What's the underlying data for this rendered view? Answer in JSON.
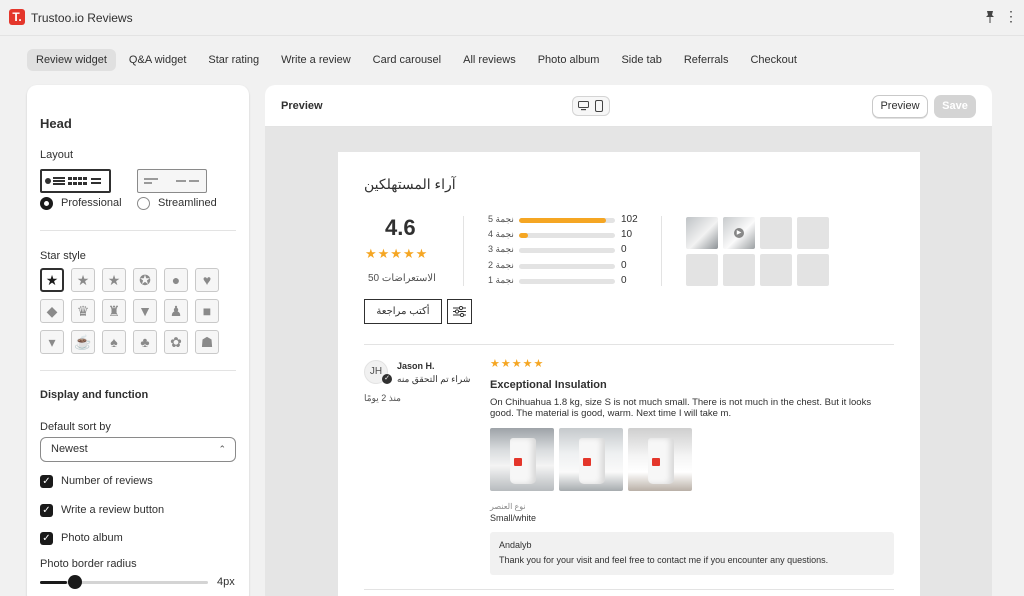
{
  "app": {
    "logo_letter": "T.",
    "title": "Trustoo.io Reviews",
    "brand_color": "#e4362b"
  },
  "topbar_icons": [
    "pin-icon",
    "more-icon"
  ],
  "tabs": [
    {
      "label": "Review widget",
      "active": true
    },
    {
      "label": "Q&A widget"
    },
    {
      "label": "Star rating"
    },
    {
      "label": "Write a review"
    },
    {
      "label": "Card carousel"
    },
    {
      "label": "All reviews"
    },
    {
      "label": "Photo album"
    },
    {
      "label": "Side tab"
    },
    {
      "label": "Referrals"
    },
    {
      "label": "Checkout"
    }
  ],
  "settings": {
    "head_title": "Head",
    "layout_label": "Layout",
    "layout_options": [
      {
        "label": "Professional",
        "selected": true
      },
      {
        "label": "Streamlined",
        "selected": false
      }
    ],
    "star_style_label": "Star style",
    "star_styles": [
      {
        "icon": "star-solid-icon",
        "glyph": "★",
        "selected": true
      },
      {
        "icon": "star-rounded-icon",
        "glyph": "★"
      },
      {
        "icon": "star-thin-icon",
        "glyph": "★"
      },
      {
        "icon": "star-square-icon",
        "glyph": "✪"
      },
      {
        "icon": "drop-icon",
        "glyph": "●"
      },
      {
        "icon": "heart-icon",
        "glyph": "♥"
      },
      {
        "icon": "diamond-icon",
        "glyph": "◆"
      },
      {
        "icon": "crown-icon",
        "glyph": "♛"
      },
      {
        "icon": "trophy-icon",
        "glyph": "♜"
      },
      {
        "icon": "shirt-icon",
        "glyph": "▼"
      },
      {
        "icon": "dress-icon",
        "glyph": "♟"
      },
      {
        "icon": "bag-icon",
        "glyph": "■"
      },
      {
        "icon": "tie-icon",
        "glyph": "▾"
      },
      {
        "icon": "cup-icon",
        "glyph": "☕"
      },
      {
        "icon": "leaf-icon",
        "glyph": "♠"
      },
      {
        "icon": "sprout-icon",
        "glyph": "♣"
      },
      {
        "icon": "paw-icon",
        "glyph": "✿"
      },
      {
        "icon": "chef-hat-icon",
        "glyph": "☗"
      }
    ],
    "display_title": "Display and function",
    "sort_label": "Default sort by",
    "sort_value": "Newest",
    "checkboxes": [
      {
        "label": "Number of reviews",
        "checked": true
      },
      {
        "label": "Write a review button",
        "checked": true
      },
      {
        "label": "Photo album",
        "checked": true
      }
    ],
    "radius_label": "Photo border radius",
    "radius_value": "4px",
    "radius_fraction": 0.16
  },
  "preview": {
    "label": "Preview",
    "preview_button": "Preview",
    "save_button": "Save",
    "device_icons": [
      "desktop-icon",
      "mobile-icon"
    ]
  },
  "widget": {
    "title": "آراء المستهلكين",
    "average": "4.6",
    "average_stars": "★★★★★",
    "total_text": "50 الاستعراضات",
    "breakdown": [
      {
        "label": "5 نجمة",
        "count": 102,
        "fraction": 0.91
      },
      {
        "label": "4 نجمة",
        "count": 10,
        "fraction": 0.09
      },
      {
        "label": "3 نجمة",
        "count": 0,
        "fraction": 0
      },
      {
        "label": "2 نجمة",
        "count": 0,
        "fraction": 0
      },
      {
        "label": "1 نجمة",
        "count": 0,
        "fraction": 0
      }
    ],
    "write_button": "أكتب مراجعة",
    "review": {
      "initials": "JH",
      "author": "Jason H.",
      "verified_text": "شراء تم التحقق منه",
      "time_ago": "منذ 2 يومًا",
      "stars": "★★★★★",
      "title": "Exceptional Insulation",
      "body_line1": "On Chihuahua 1.8 kg, size S is not much small. There is not much in the chest. But it looks",
      "body_line2": "good. The material is good, warm. Next time I will take m.",
      "variant_label": "نوع العنصر",
      "variant_value": "Small/white",
      "reply_author": "Andalyb",
      "reply_text": "Thank you for your visit and feel free to contact me if you encounter any questions."
    }
  },
  "colors": {
    "accent_star": "#f5a623",
    "primary_dark": "#303030"
  }
}
